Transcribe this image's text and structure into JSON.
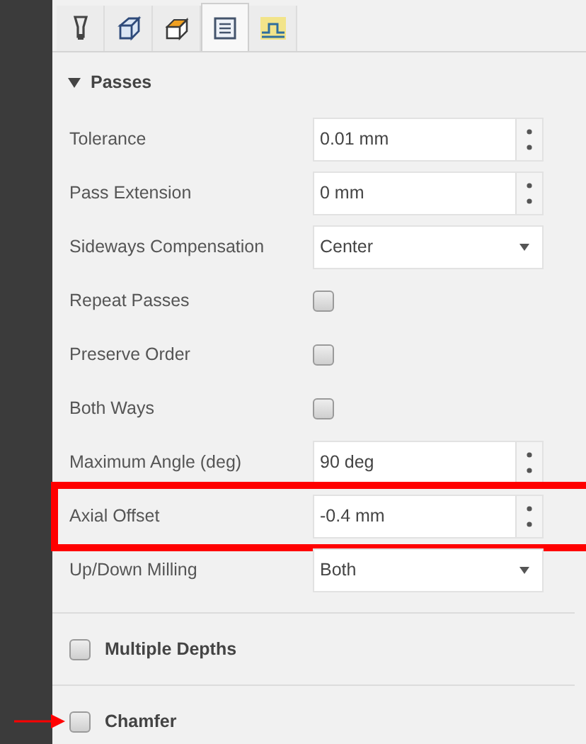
{
  "tabs": [
    {
      "selected": false
    },
    {
      "selected": false
    },
    {
      "selected": false
    },
    {
      "selected": true
    },
    {
      "selected": false
    }
  ],
  "section": {
    "title": "Passes",
    "expanded": true
  },
  "rows": [
    {
      "kind": "spinner",
      "label": "Tolerance",
      "value": "0.01 mm",
      "highlighted": false
    },
    {
      "kind": "spinner",
      "label": "Pass Extension",
      "value": "0 mm",
      "highlighted": false
    },
    {
      "kind": "dropdown",
      "label": "Sideways Compensation",
      "value": "Center",
      "highlighted": false
    },
    {
      "kind": "checkbox",
      "label": "Repeat Passes",
      "checked": false,
      "highlighted": false
    },
    {
      "kind": "checkbox",
      "label": "Preserve Order",
      "checked": false,
      "highlighted": false
    },
    {
      "kind": "checkbox",
      "label": "Both Ways",
      "checked": false,
      "highlighted": false
    },
    {
      "kind": "spinner",
      "label": "Maximum Angle (deg)",
      "value": "90 deg",
      "highlighted": false
    },
    {
      "kind": "spinner",
      "label": "Axial Offset",
      "value": "-0.4 mm",
      "highlighted": true
    },
    {
      "kind": "dropdown",
      "label": "Up/Down Milling",
      "value": "Both",
      "highlighted": false
    }
  ],
  "groups": [
    {
      "label": "Multiple Depths",
      "checked": false,
      "pointed": false
    },
    {
      "label": "Chamfer",
      "checked": false,
      "pointed": true
    }
  ]
}
